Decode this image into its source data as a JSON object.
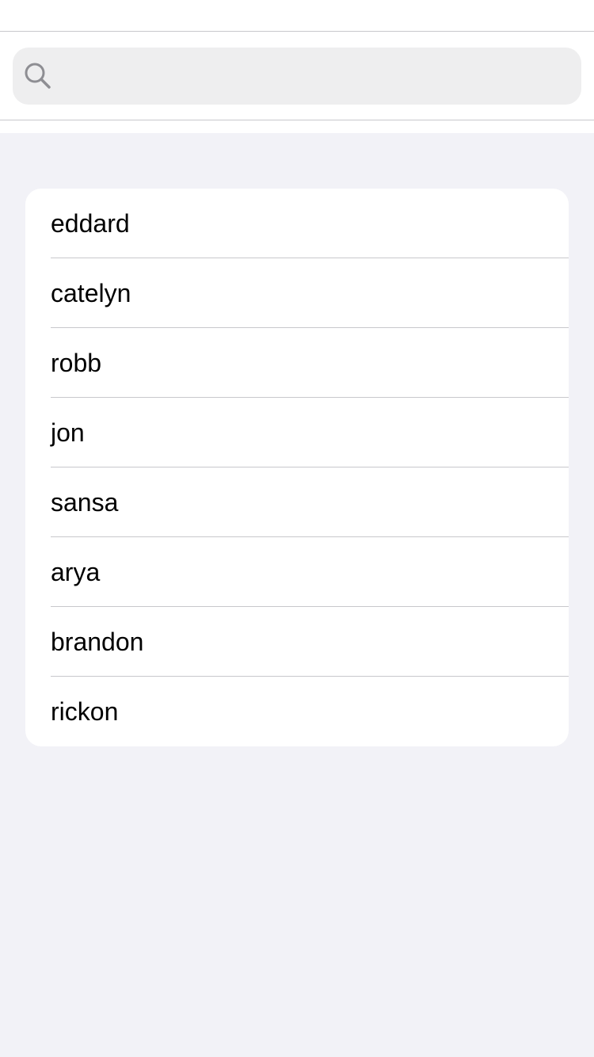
{
  "search": {
    "value": "",
    "placeholder": "",
    "icon": "search-icon"
  },
  "list": {
    "items": [
      {
        "label": "eddard"
      },
      {
        "label": "catelyn"
      },
      {
        "label": "robb"
      },
      {
        "label": "jon"
      },
      {
        "label": "sansa"
      },
      {
        "label": "arya"
      },
      {
        "label": "brandon"
      },
      {
        "label": "rickon"
      }
    ]
  },
  "colors": {
    "background": "#f2f2f7",
    "card": "#ffffff",
    "search_field": "#eeeeef",
    "separator": "#c8c8cc",
    "icon": "#8e8e93"
  }
}
